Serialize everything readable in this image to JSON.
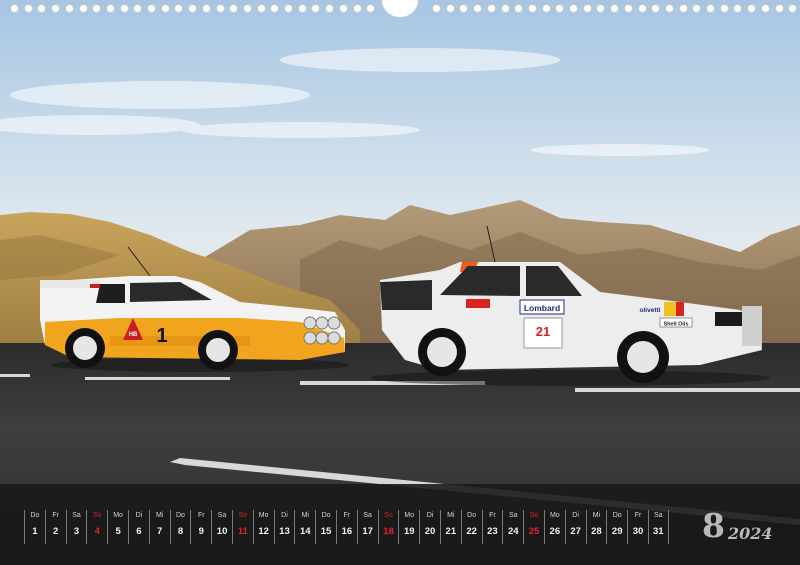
{
  "calendar": {
    "month_number": "8",
    "year": "2024",
    "days": [
      {
        "name": "Do",
        "num": "1",
        "red": false
      },
      {
        "name": "Fr",
        "num": "2",
        "red": false
      },
      {
        "name": "Sa",
        "num": "3",
        "red": false
      },
      {
        "name": "So",
        "num": "4",
        "red": true
      },
      {
        "name": "Mo",
        "num": "5",
        "red": false
      },
      {
        "name": "Di",
        "num": "6",
        "red": false
      },
      {
        "name": "Mi",
        "num": "7",
        "red": false
      },
      {
        "name": "Do",
        "num": "8",
        "red": false
      },
      {
        "name": "Fr",
        "num": "9",
        "red": false
      },
      {
        "name": "Sa",
        "num": "10",
        "red": false
      },
      {
        "name": "So",
        "num": "11",
        "red": true
      },
      {
        "name": "Mo",
        "num": "12",
        "red": false
      },
      {
        "name": "Di",
        "num": "13",
        "red": false
      },
      {
        "name": "Mi",
        "num": "14",
        "red": false
      },
      {
        "name": "Do",
        "num": "15",
        "red": false
      },
      {
        "name": "Fr",
        "num": "16",
        "red": false
      },
      {
        "name": "Sa",
        "num": "17",
        "red": false
      },
      {
        "name": "So",
        "num": "18",
        "red": true
      },
      {
        "name": "Mo",
        "num": "19",
        "red": false
      },
      {
        "name": "Di",
        "num": "20",
        "red": false
      },
      {
        "name": "Mi",
        "num": "21",
        "red": false
      },
      {
        "name": "Do",
        "num": "22",
        "red": false
      },
      {
        "name": "Fr",
        "num": "23",
        "red": false
      },
      {
        "name": "Sa",
        "num": "24",
        "red": false
      },
      {
        "name": "So",
        "num": "25",
        "red": true
      },
      {
        "name": "Mo",
        "num": "26",
        "red": false
      },
      {
        "name": "Di",
        "num": "27",
        "red": false
      },
      {
        "name": "Mi",
        "num": "28",
        "red": false
      },
      {
        "name": "Do",
        "num": "29",
        "red": false
      },
      {
        "name": "Fr",
        "num": "30",
        "red": false
      },
      {
        "name": "Sa",
        "num": "31",
        "red": false
      }
    ]
  },
  "photo": {
    "left_car_number": "1",
    "left_car_plate": "HB",
    "right_car_sponsor": "Lombard",
    "right_car_number": "21",
    "right_car_sponsor2": "Shell Oils",
    "right_car_sponsor3": "olivetti",
    "colors": {
      "sky_top": "#a9c8e4",
      "sky_bottom": "#e9eef0",
      "mountain": "#a08566",
      "asphalt": "#333333",
      "left_car_yellow": "#f1a51f",
      "right_car_white": "#ececec",
      "weekend_red": "#e0222a"
    }
  }
}
